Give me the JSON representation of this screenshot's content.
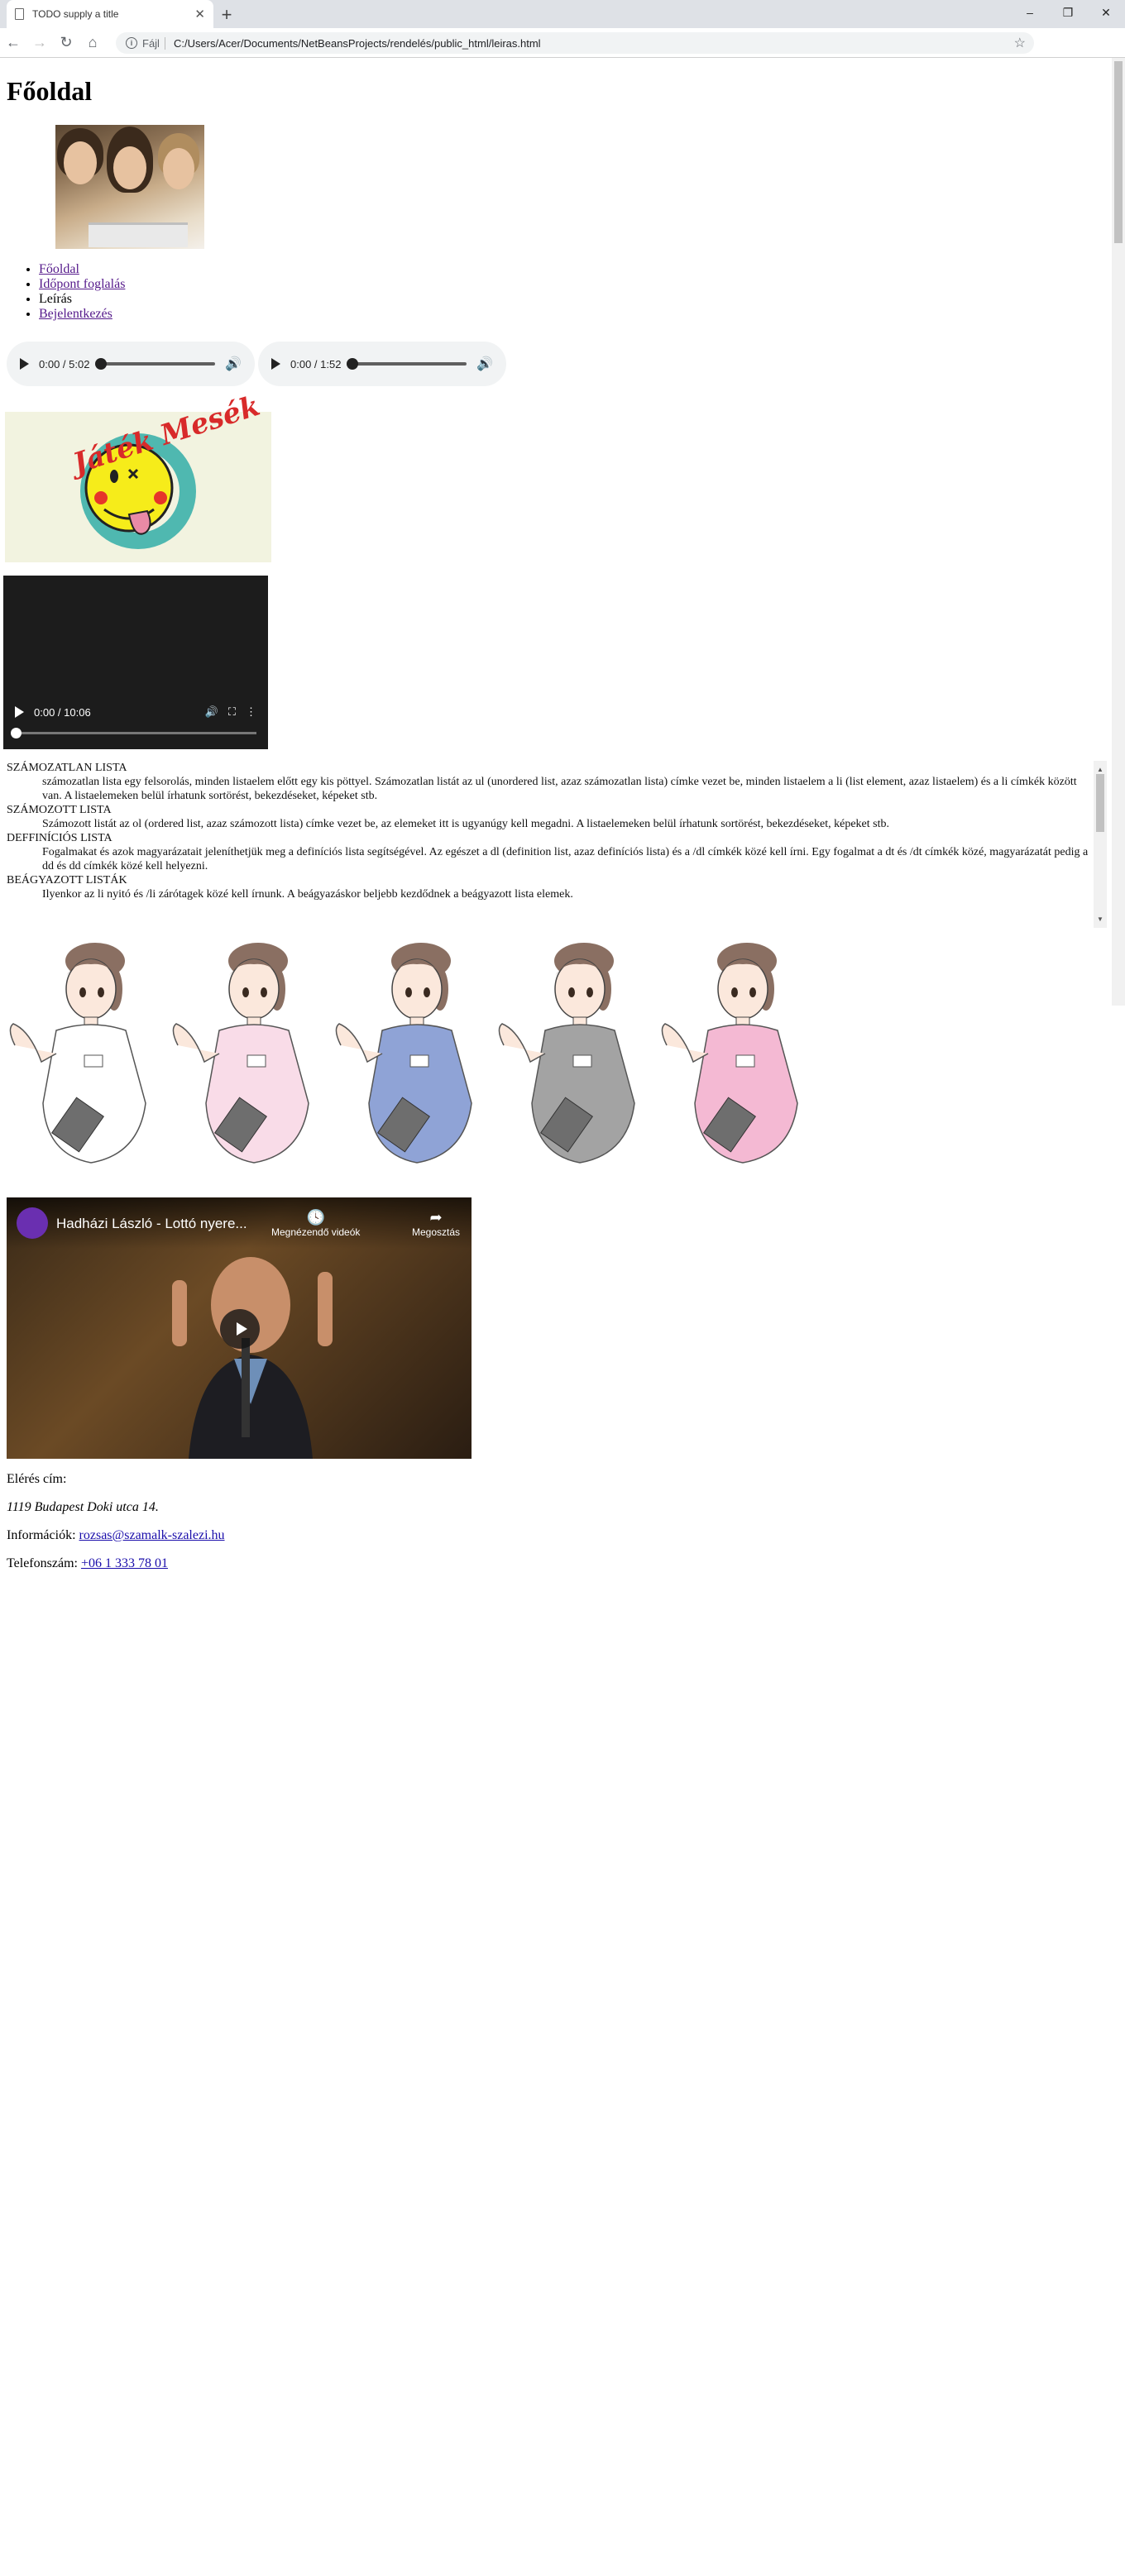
{
  "browser": {
    "tab_title": "TODO supply a title",
    "new_tab": "+",
    "scheme": "Fájl",
    "url": "C:/Users/Acer/Documents/NetBeansProjects/rendelés/public_html/leiras.html",
    "window_controls": [
      "–",
      "❐",
      "✕"
    ]
  },
  "page": {
    "title": "Főoldal",
    "nav": [
      {
        "label": "Főoldal",
        "link": true
      },
      {
        "label": "Időpont foglalás",
        "link": true
      },
      {
        "label": "Leírás",
        "link": false
      },
      {
        "label": "Bejelentkezés",
        "link": true
      }
    ],
    "audio": [
      {
        "time": "0:00 / 5:02"
      },
      {
        "time": "0:00 / 1:52"
      }
    ],
    "logo_text": "Játék Mesék",
    "video": {
      "time": "0:00 / 10:06"
    },
    "lists": [
      {
        "term": "SZÁMOZATLAN LISTA",
        "desc": "számozatlan lista egy felsorolás, minden listaelem előtt egy kis pöttyel. Számozatlan listát az ul (unordered list, azaz számozatlan lista) címke vezet be, minden listaelem a li (list element, azaz listaelem) és a li címkék között van. A listaelemeken belül írhatunk sortörést, bekezdéseket, képeket stb."
      },
      {
        "term": "SZÁMOZOTT LISTA",
        "desc": "Számozott listát az ol (ordered list, azaz számozott lista) címke vezet be, az elemeket itt is ugyanúgy kell megadni. A listaelemeken belül írhatunk sortörést, bekezdéseket, képeket stb."
      },
      {
        "term": "DEFFINÍCIÓS LISTA",
        "desc": "Fogalmakat és azok magyarázatait jeleníthetjük meg a definíciós lista segítségével. Az egészet a dl (definition list, azaz definíciós lista) és a /dl címkék közé kell írni. Egy fogalmat a dt és /dt címkék közé, magyarázatát pedig a dd és dd címkék közé kell helyezni."
      },
      {
        "term": "BEÁGYAZOTT LISTÁK",
        "desc": "Ilyenkor az li nyitó és /li zárótagek közé kell írnunk. A beágyazáskor beljebb kezdődnek a beágyazott lista elemek."
      }
    ],
    "nurse_colors": [
      "#ffffff",
      "#f9dce8",
      "#8fa3d6",
      "#a3a3a3",
      "#f4b9d3"
    ],
    "youtube": {
      "title": "Hadházi László - Lottó nyere...",
      "watch_later": "Megnézendő videók",
      "share": "Megosztás"
    },
    "contact": {
      "address_label": "Elérés cím:",
      "address": "1119 Budapest Doki utca 14.",
      "info_label": "Információk:",
      "email": "rozsas@szamalk-szalezi.hu",
      "phone_label": "Telefonszám:",
      "phone": "+06 1 333 78 01"
    }
  }
}
